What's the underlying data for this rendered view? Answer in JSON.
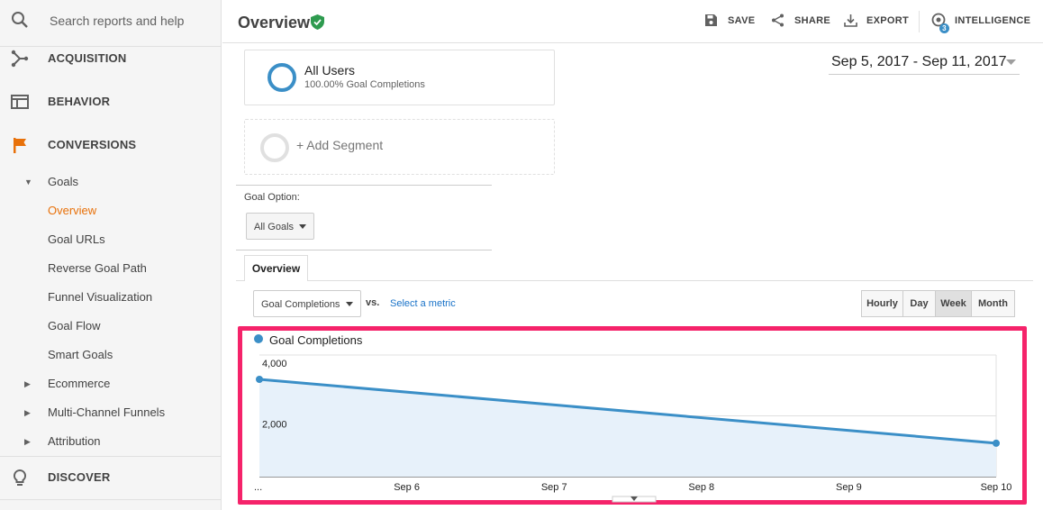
{
  "sidebar": {
    "search_placeholder": "Search reports and help",
    "sections": {
      "acquisition": "ACQUISITION",
      "behavior": "BEHAVIOR",
      "conversions": "CONVERSIONS",
      "discover": "DISCOVER"
    },
    "goals": {
      "label": "Goals",
      "items": [
        "Overview",
        "Goal URLs",
        "Reverse Goal Path",
        "Funnel Visualization",
        "Goal Flow",
        "Smart Goals"
      ]
    },
    "collapsed": [
      "Ecommerce",
      "Multi-Channel Funnels",
      "Attribution"
    ],
    "active_color": "#e8710a"
  },
  "header": {
    "title": "Overview",
    "save": "SAVE",
    "share": "SHARE",
    "export": "EXPORT",
    "intelligence": "INTELLIGENCE",
    "intelligence_badge": "3"
  },
  "segments": {
    "all_users": "All Users",
    "all_users_sub": "100.00% Goal Completions",
    "add": "+ Add Segment"
  },
  "date_range": "Sep 5, 2017 - Sep 11, 2017",
  "goal_option": {
    "label": "Goal Option:",
    "value": "All Goals"
  },
  "tab": "Overview",
  "metric": {
    "selected": "Goal Completions",
    "vs": "vs.",
    "select_metric": "Select a metric"
  },
  "granularity": {
    "hourly": "Hourly",
    "day": "Day",
    "week": "Week",
    "month": "Month",
    "selected": "Week"
  },
  "chart_data": {
    "type": "area",
    "series": [
      {
        "name": "Goal Completions",
        "values": [
          3200,
          1100
        ],
        "color": "#3b8fc7"
      }
    ],
    "x_points": [
      5.0,
      10.0
    ],
    "x_ticks": [
      {
        "x": 5.0,
        "label": "..."
      },
      {
        "x": 6.0,
        "label": "Sep 6"
      },
      {
        "x": 7.0,
        "label": "Sep 7"
      },
      {
        "x": 8.0,
        "label": "Sep 8"
      },
      {
        "x": 9.0,
        "label": "Sep 9"
      },
      {
        "x": 10.0,
        "label": "Sep 10"
      }
    ],
    "y_ticks": [
      {
        "value": 4000,
        "label": "4,000"
      },
      {
        "value": 2000,
        "label": "2,000"
      }
    ],
    "ylim": [
      0,
      4000
    ],
    "grid": true,
    "legend": "top-left"
  }
}
